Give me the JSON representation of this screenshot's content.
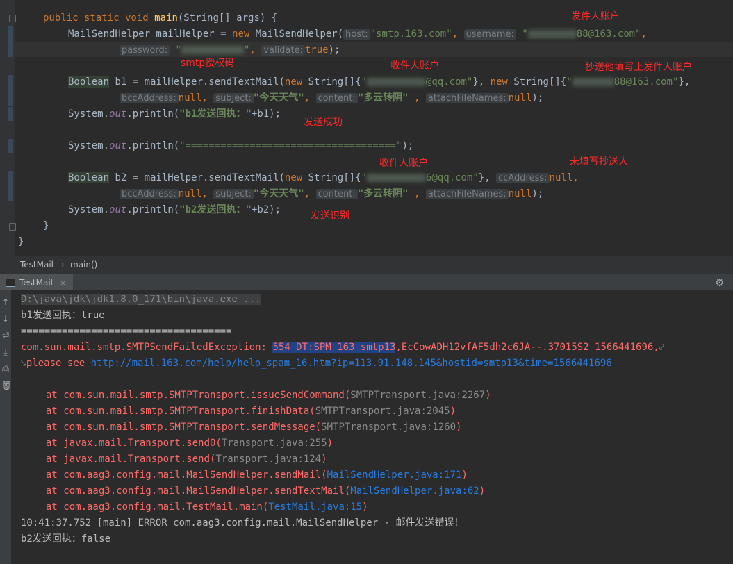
{
  "editor": {
    "l1": {
      "p1": "public static void ",
      "fn": "main",
      "p2": "(String[] args) {"
    },
    "l2": {
      "p1": "MailSendHelper mailHelper = ",
      "kw": "new",
      "p2": " MailSendHelper(",
      "h1": "host:",
      "s1": "\"smtp.163.com\"",
      "c1": ",",
      "h2": "username:",
      "s2a": "\"",
      "s2b": "88@163.com\"",
      "c2": ","
    },
    "l3": {
      "h1": "password:",
      "s1a": "\"",
      "s1b": "\"",
      "c1": ",",
      "h2": "validate:",
      "kw": "true",
      "p": ");"
    },
    "l4": {
      "t": "Boolean",
      "p1": " b1 = mailHelper.sendTextMail(",
      "kw1": "new",
      "p2": " String[]{",
      "s1a": "\"",
      "s1b": "@qq.com\"",
      "p3": "}, ",
      "kw2": "new",
      "p4": " String[]{",
      "s2a": "\"",
      "s2b": "88@163.com\"",
      "p5": "},"
    },
    "l5": {
      "h1": "bccAddress:",
      "n1": "null",
      "c1": ",",
      "h2": "subject:",
      "s1": "\"今天天气\"",
      "c2": ",",
      "h3": "content:",
      "s2": "\"多云转阴\"",
      "c3": " ,",
      "h4": "attachFileNames:",
      "n2": "null",
      "p": ");"
    },
    "l6": {
      "p1": "System.",
      "it": "out",
      "p2": ".println(",
      "s": "\"b1发送回执：\"",
      "p3": "+b1);"
    },
    "l7": {
      "p1": "System.",
      "it": "out",
      "p2": ".println(",
      "s": "\"====================================\"",
      "p3": ");"
    },
    "l8": {
      "t": "Boolean",
      "p1": " b2 = mailHelper.sendTextMail(",
      "kw1": "new",
      "p2": " String[]{",
      "s1a": "\"",
      "s1b": "6@qq.com\"",
      "p3": "},",
      "h1": "ccAddress:",
      "n1": "null",
      "c1": ","
    },
    "l9": {
      "h1": "bccAddress:",
      "n1": "null",
      "c1": ",",
      "h2": "subject:",
      "s1": "\"今天天气\"",
      "c2": ",",
      "h3": "content:",
      "s2": "\"多云转阴\"",
      "c3": " ,",
      "h4": "attachFileNames:",
      "n2": "null",
      "p": ");"
    },
    "l10": {
      "p1": "System.",
      "it": "out",
      "p2": ".println(",
      "s": "\"b2发送回执：\"",
      "p3": "+b2);"
    },
    "l11": "}",
    "l12": "}"
  },
  "annotations": {
    "a1": "发件人账户",
    "a2": "smtp授权码",
    "a3": "收件人账户",
    "a4": "抄送他填写上发件人账户",
    "a5": "发送成功",
    "a6": "收件人账户",
    "a7": "未填写抄送人",
    "a8": "发送识别"
  },
  "breadcrumb": {
    "b1": "TestMail",
    "sep": "›",
    "b2": "main()"
  },
  "run_tab": {
    "label": "TestMail",
    "close": "×"
  },
  "console": {
    "c1": "D:\\java\\jdk\\jdk1.8.0_171\\bin\\java.exe ...",
    "c2": "b1发送回执：true",
    "c3": "====================================",
    "c4a": "com.sun.mail.smtp.SMTPSendFailedException: ",
    "c4b": "554 DT:SPM 163 smtp13",
    "c4c": ",EcCowADH12vfAF5dh2c6JA--.37015S2 1566441696,",
    "c5a": "please see ",
    "c5b": "http://mail.163.com/help/help_spam_16.htm?ip=113.91.148.145&hostid=smtp13&time=1566441696",
    "s1a": "at com.sun.mail.smtp.SMTPTransport.issueSendCommand(",
    "s1b": "SMTPTransport.java:2267",
    "s1c": ")",
    "s2a": "at com.sun.mail.smtp.SMTPTransport.finishData(",
    "s2b": "SMTPTransport.java:2045",
    "s2c": ")",
    "s3a": "at com.sun.mail.smtp.SMTPTransport.sendMessage(",
    "s3b": "SMTPTransport.java:1260",
    "s3c": ")",
    "s4a": "at javax.mail.Transport.send0(",
    "s4b": "Transport.java:255",
    "s4c": ")",
    "s5a": "at javax.mail.Transport.send(",
    "s5b": "Transport.java:124",
    "s5c": ")",
    "s6a": "at com.aag3.config.mail.MailSendHelper.sendMail(",
    "s6b": "MailSendHelper.java:171",
    "s6c": ")",
    "s7a": "at com.aag3.config.mail.MailSendHelper.sendTextMail(",
    "s7b": "MailSendHelper.java:62",
    "s7c": ")",
    "s8a": "at com.aag3.config.mail.TestMail.main(",
    "s8b": "TestMail.java:15",
    "s8c": ")",
    "c6": "10:41:37.752 [main] ERROR com.aag3.config.mail.MailSendHelper - 邮件发送错误！",
    "c7": "b2发送回执：false"
  },
  "colors": {
    "background": "#2b2b2b",
    "keyword": "#cc7832",
    "string": "#6a8759",
    "error": "#ff6b68",
    "link": "#287bde",
    "annotation": "#ff2a2a"
  }
}
